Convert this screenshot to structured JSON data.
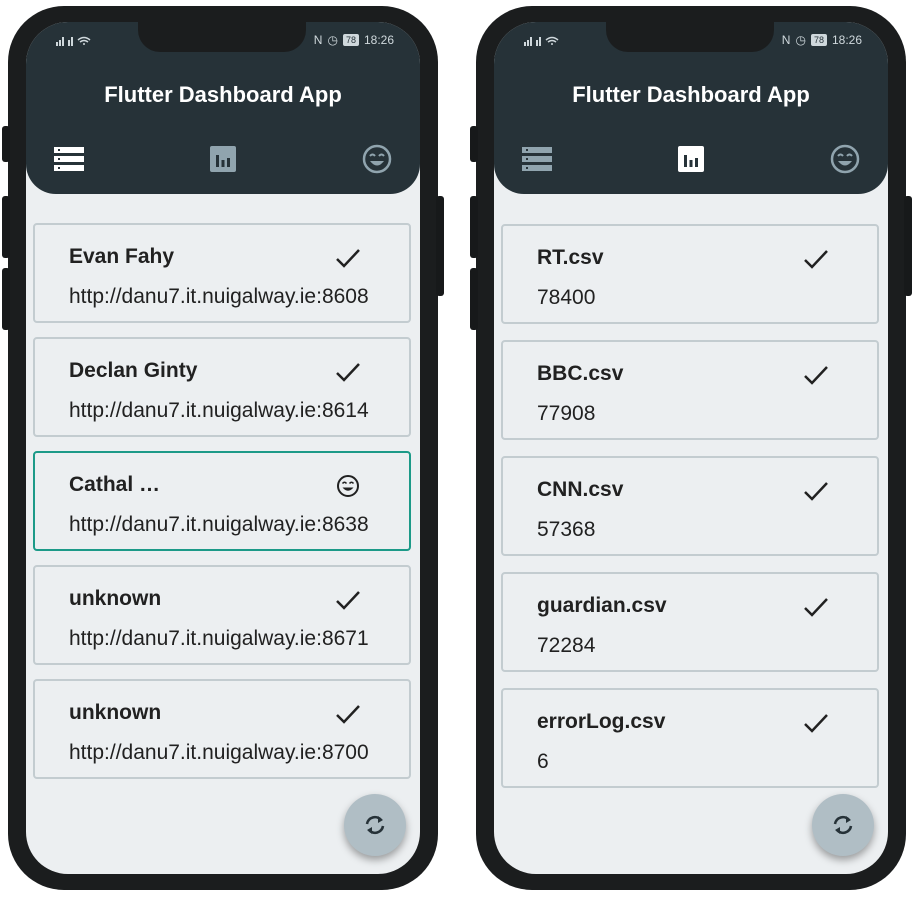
{
  "phones": [
    {
      "status_time": "18:26",
      "battery": "78",
      "app_title": "Flutter Dashboard App",
      "tabs": [
        {
          "icon": "list-icon",
          "active": true
        },
        {
          "icon": "bar-chart-icon",
          "active": false
        },
        {
          "icon": "smiley-icon",
          "active": false
        }
      ],
      "items": [
        {
          "name": "Evan Fahy",
          "value": "http://danu7.it.nuigalway.ie:8608",
          "status_icon": "check-icon"
        },
        {
          "name": "Declan Ginty",
          "value": "http://danu7.it.nuigalway.ie:8614",
          "status_icon": "check-icon"
        },
        {
          "name": "Cathal …",
          "value": "http://danu7.it.nuigalway.ie:8638",
          "status_icon": "smiley-icon"
        },
        {
          "name": "unknown",
          "value": "http://danu7.it.nuigalway.ie:8671",
          "status_icon": "check-icon"
        },
        {
          "name": "unknown",
          "value": "http://danu7.it.nuigalway.ie:8700",
          "status_icon": "check-icon"
        }
      ],
      "fab_icon": "refresh-icon"
    },
    {
      "status_time": "18:26",
      "battery": "78",
      "app_title": "Flutter Dashboard App",
      "tabs": [
        {
          "icon": "list-icon",
          "active": false
        },
        {
          "icon": "bar-chart-icon",
          "active": true
        },
        {
          "icon": "smiley-icon",
          "active": false
        }
      ],
      "items": [
        {
          "name": "RT.csv",
          "value": "78400",
          "status_icon": "check-icon"
        },
        {
          "name": "BBC.csv",
          "value": "77908",
          "status_icon": "check-icon"
        },
        {
          "name": "CNN.csv",
          "value": "57368",
          "status_icon": "check-icon"
        },
        {
          "name": "guardian.csv",
          "value": "72284",
          "status_icon": "check-icon"
        },
        {
          "name": "errorLog.csv",
          "value": "6",
          "status_icon": "check-icon"
        }
      ],
      "fab_icon": "refresh-icon"
    }
  ],
  "colors": {
    "appbar": "#263238",
    "background": "#eceff1",
    "card_border": "#c3ccd0",
    "active_border": "#1c9a88",
    "fab": "#b0bec5",
    "tab_active": "#ffffff",
    "tab_inactive": "#90a4ae"
  }
}
